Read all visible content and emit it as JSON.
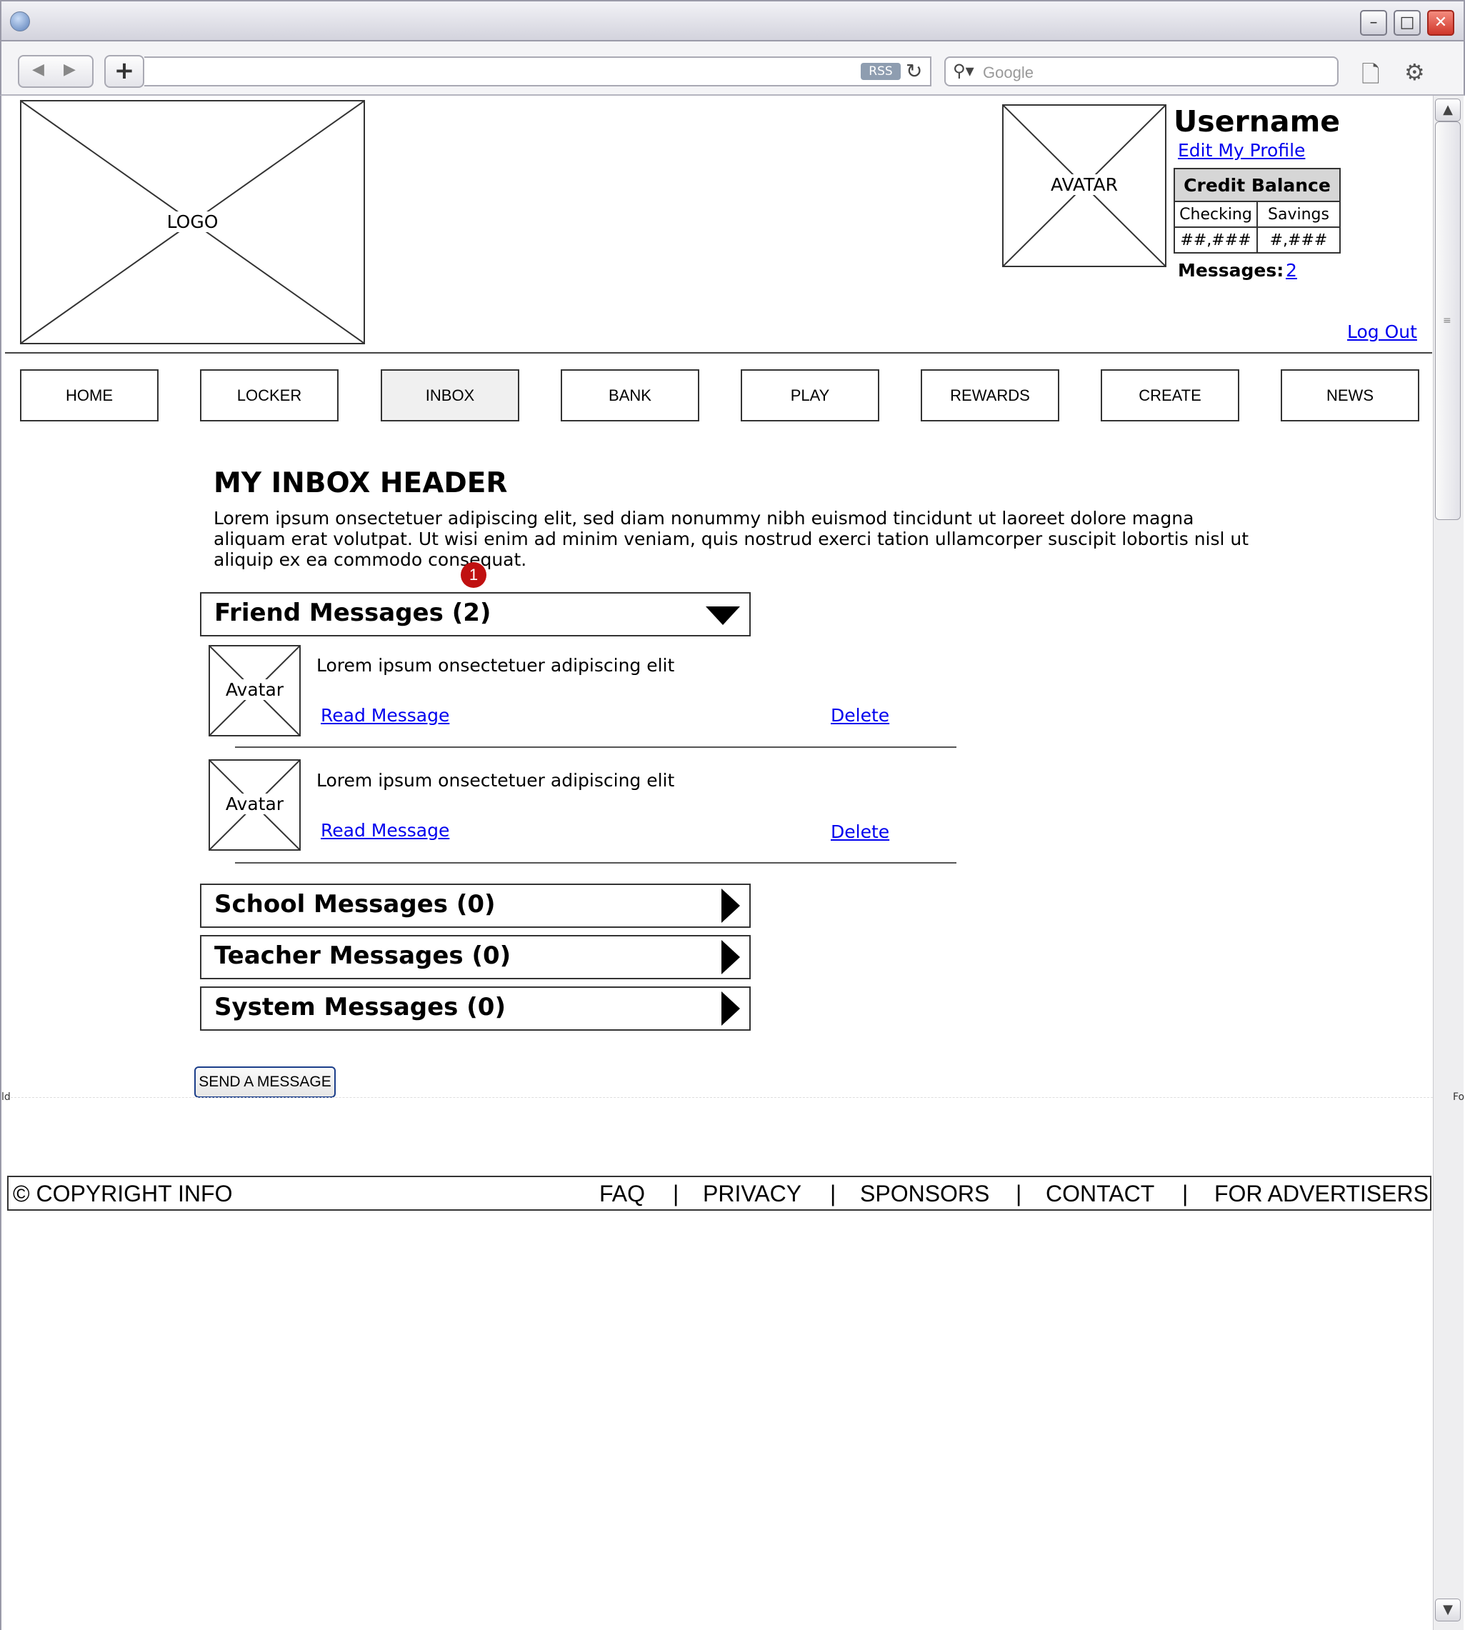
{
  "browser": {
    "search_placeholder": "Google",
    "rss_label": "RSS",
    "controls": {
      "minimize": "–",
      "maximize": "□",
      "close": "✕"
    }
  },
  "header": {
    "logo_label": "LOGO",
    "avatar_label": "AVATAR",
    "username": "Username",
    "edit_profile": "Edit My Profile",
    "credit": {
      "title": "Credit Balance",
      "col1": "Checking",
      "col2": "Savings",
      "val1": "##,###",
      "val2": "#,###"
    },
    "messages_label": "Messages:",
    "messages_count": "2",
    "logout": "Log Out"
  },
  "nav": {
    "items": [
      "HOME",
      "LOCKER",
      "INBOX",
      "BANK",
      "PLAY",
      "REWARDS",
      "CREATE",
      "NEWS"
    ],
    "active": "INBOX"
  },
  "main": {
    "heading": "MY INBOX HEADER",
    "intro": "Lorem ipsum onsectetuer adipiscing elit, sed diam nonummy nibh euismod tincidunt ut laoreet dolore magna aliquam erat volutpat. Ut wisi enim ad minim veniam, quis nostrud exerci tation ullamcorper suscipit lobortis nisl ut aliquip ex ea commodo consequat.",
    "annotation_badge": "1",
    "friend_section": {
      "title": "Friend Messages (2)",
      "messages": [
        {
          "avatar_label": "Avatar",
          "text": "Lorem ipsum onsectetuer adipiscing elit",
          "read": "Read Message",
          "delete": "Delete"
        },
        {
          "avatar_label": "Avatar",
          "text": "Lorem ipsum onsectetuer adipiscing elit",
          "read": "Read Message",
          "delete": "Delete"
        }
      ]
    },
    "collapsed_sections": [
      "School Messages (0)",
      "Teacher Messages (0)",
      "System Messages (0)"
    ],
    "send_button": "SEND A MESSAGE"
  },
  "fold_marker": {
    "left": "ld",
    "right": "Fo"
  },
  "footer": {
    "copyright": "© COPYRIGHT INFO",
    "links": [
      "FAQ",
      "PRIVACY",
      "SPONSORS",
      "CONTACT",
      "FOR ADVERTISERS"
    ],
    "separator": "|"
  }
}
